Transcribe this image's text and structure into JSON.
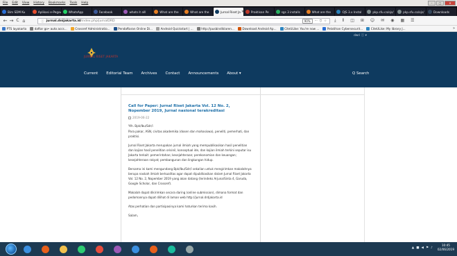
{
  "menubar": [
    "File",
    "Edit",
    "View",
    "History",
    "Bookmarks",
    "Tools",
    "Help"
  ],
  "window_controls": [
    "–",
    "□",
    "✕"
  ],
  "tabs": [
    {
      "label": "Bim SDM Ku",
      "color": "#2a6fd6",
      "active": false
    },
    {
      "label": "Aplikasi e-Pegaw",
      "color": "#e54d2e",
      "active": false
    },
    {
      "label": "WhatsApp",
      "color": "#25d366",
      "active": false
    },
    {
      "label": "Facebook",
      "color": "#3b5998",
      "active": false
    },
    {
      "label": "whats it alll",
      "color": "#9b59b6",
      "active": false
    },
    {
      "label": "What are the",
      "color": "#e67e22",
      "active": false
    },
    {
      "label": "What are the",
      "color": "#e67e22",
      "active": false
    },
    {
      "label": "Jurnal Riset Ja",
      "color": "#0e3a5f",
      "active": true
    },
    {
      "label": "Praktisan Pe",
      "color": "#c0392b",
      "active": false
    },
    {
      "label": "sgs 3 installs",
      "color": "#27ae60",
      "active": false
    },
    {
      "label": "What are the",
      "color": "#e67e22",
      "active": false
    },
    {
      "label": "OJS 3.x Instal",
      "color": "#2980b9",
      "active": false
    },
    {
      "label": "pkp.sfu.ca/ojs/",
      "color": "#7f8c8d",
      "active": false
    },
    {
      "label": "pkp.sfu.ca/ojs/",
      "color": "#7f8c8d",
      "active": false
    },
    {
      "label": "Downloads",
      "color": "#34495e",
      "active": false
    }
  ],
  "nav": {
    "back": "←",
    "forward": "→",
    "reload": "C",
    "home": "⌂"
  },
  "url": {
    "host": "jurnal.dnijakarta.id",
    "path": "/index.php/jurnalDRD",
    "zoom": "90%",
    "more": "···",
    "pocket": "⛉",
    "star": "☆"
  },
  "toolbar_icons": [
    "⤓",
    "⫴",
    "◫",
    "⊞",
    "☺",
    "✉",
    "◉",
    "▦",
    "☰"
  ],
  "bookmarks": [
    {
      "label": "PTS layakarta",
      "color": "#3b78c9"
    },
    {
      "label": "daftar go• auto accs...",
      "color": "#7a7a7a"
    },
    {
      "label": "Crossref Administratio...",
      "color": "#f0a62a"
    },
    {
      "label": "Pendaftaran Online Di...",
      "color": "#1b4f8a"
    },
    {
      "label": "Android Quickstart | ...",
      "color": "#a0a0a0"
    },
    {
      "label": "http://pusbindiklaren...",
      "color": "#7a7a7a"
    },
    {
      "label": "Download Android Ap...",
      "color": "#d35400"
    },
    {
      "label": "CiteULike: You're now ...",
      "color": "#2e86c1"
    },
    {
      "label": "Pelatihan Cybersecurit...",
      "color": "#2a6fd6"
    },
    {
      "label": "CiteULike: My library J...",
      "color": "#2e86c1"
    }
  ],
  "bookmarks_more": "»",
  "site": {
    "user_menu": "dwri ⓘ ▾",
    "logo_caption": "JURNAL RISET JAKARTA",
    "nav": [
      "Current",
      "Editorial Team",
      "Archives",
      "Contact",
      "Announcements",
      "About ▾"
    ],
    "search": "Q  Search"
  },
  "article": {
    "title": "Call for Paper: Jurnal Riset Jakarta Vol. 12 No. 2, Nopember 2019, Jurnal nasional terakreditasi",
    "date": "2019-06-22",
    "paragraphs": [
      "Yth. Bpk/Ibu/Sdr/i",
      "Para pakar, ASN, civitas akademika (dosen dan mahasiswa), peneliti, pemerhati, dan praktisi.",
      "Jurnal Riset Jakarta merupakan jurnal ilmiah yang mempublikasikan hasil penelitian dan kajian hasil penelitian orisinil, konseptual ide, dan kajian ilmiah terkini seputar isu Jakarta terkait: pemerintahan; kesejahteraan; perekonomian dan keuangan; kesejahteraan rakyat; pembangunan dan lingkungan hidup.",
      "Bersama ini kami mengundang Bpk/Ibu/Sdr/i sekalian untuk mengirimkan makalahnya berupa naskah ilmiah berkualitas agar dapat dipublikasikan dalam Jurnal Riset Jakarta Vol. 12 No. 2, Nopember 2019 yang akan datang (terindeks Arjuna/Sinta 4, Garuda, Google Scholar, dan Crossref).",
      "Makalah dapat dikirimkan secara daring (online submission), dimana format dan pedomannya dapat dilihat di laman web http://jurnal.drdjakarta.id",
      "Atas perhatian dan partisipasinya kami haturkan terima kasih.",
      "Salam,"
    ]
  },
  "taskbar": {
    "apps": [
      {
        "color": "#3b8fe0"
      },
      {
        "color": "#e8601c"
      },
      {
        "color": "#f2c14e"
      },
      {
        "color": "#2ecc71"
      },
      {
        "color": "#e74c3c"
      },
      {
        "color": "#9b59b6"
      },
      {
        "color": "#3b8fe0"
      },
      {
        "color": "#e8601c"
      },
      {
        "color": "#1abc9c"
      },
      {
        "color": "#95a5a6"
      }
    ],
    "tray_icons": [
      "▲",
      "■",
      "◀",
      "⚑",
      "♪"
    ],
    "time": "10:45",
    "date": "02/06/2019"
  },
  "colors": {
    "header_bg": "#0e3a5f",
    "link": "#1d6fa8",
    "taskbar": "#1d3a52"
  }
}
